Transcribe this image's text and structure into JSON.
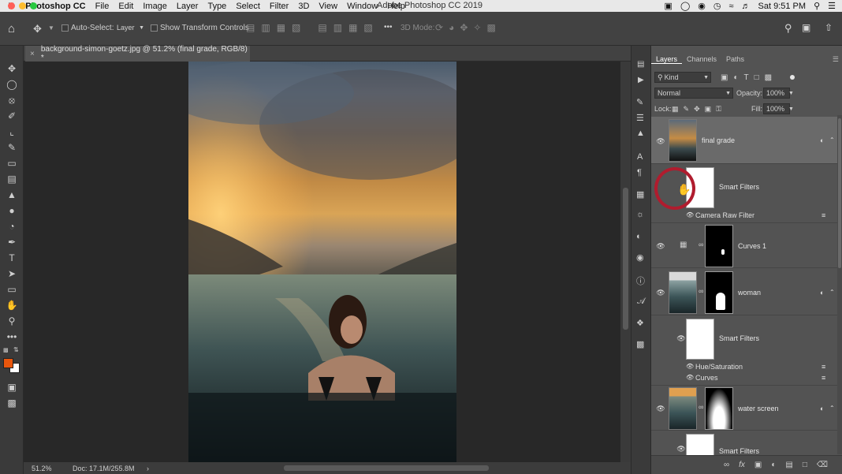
{
  "menubar": {
    "apple": "",
    "app_name": "Photoshop CC",
    "items": [
      "File",
      "Edit",
      "Image",
      "Layer",
      "Type",
      "Select",
      "Filter",
      "3D",
      "View",
      "Window",
      "Help"
    ],
    "window_title": "Adobe Photoshop CC 2019",
    "clock": "Sat 9:51 PM",
    "colors": {
      "close": "#ff5f57",
      "minimize": "#febc2e",
      "zoom": "#28c840"
    }
  },
  "options_bar": {
    "auto_select_label": "Auto-Select:",
    "auto_select_target": "Layer",
    "show_transform_label": "Show Transform Controls",
    "three_d_mode_label": "3D Mode:",
    "more_label": "•••"
  },
  "document": {
    "tab_title": "background-simon-goetz.jpg @ 51.2% (final grade, RGB/8) *",
    "close_glyph": "×"
  },
  "status_bar": {
    "zoom": "51.2%",
    "doc_size": "Doc: 17.1M/255.8M",
    "arrow": "›"
  },
  "tools": {
    "more_label": "•••",
    "foreground_color": "#e8560d",
    "background_color": "#ffffff"
  },
  "layers_panel": {
    "tabs": [
      "Layers",
      "Channels",
      "Paths"
    ],
    "filter_kind": "Kind",
    "blend_mode": "Normal",
    "opacity_label": "Opacity:",
    "opacity_value": "100%",
    "lock_label": "Lock:",
    "fill_label": "Fill:",
    "fill_value": "100%",
    "layers": [
      {
        "name": "final grade"
      },
      {
        "name": "Smart Filters"
      },
      {
        "name": "Camera Raw Filter"
      },
      {
        "name": "Curves 1"
      },
      {
        "name": "woman"
      },
      {
        "name": "Smart Filters"
      },
      {
        "name": "Hue/Saturation"
      },
      {
        "name": "Curves"
      },
      {
        "name": "water screen"
      },
      {
        "name": "Smart Filters"
      }
    ],
    "highlight_color": "#b01c2e"
  }
}
